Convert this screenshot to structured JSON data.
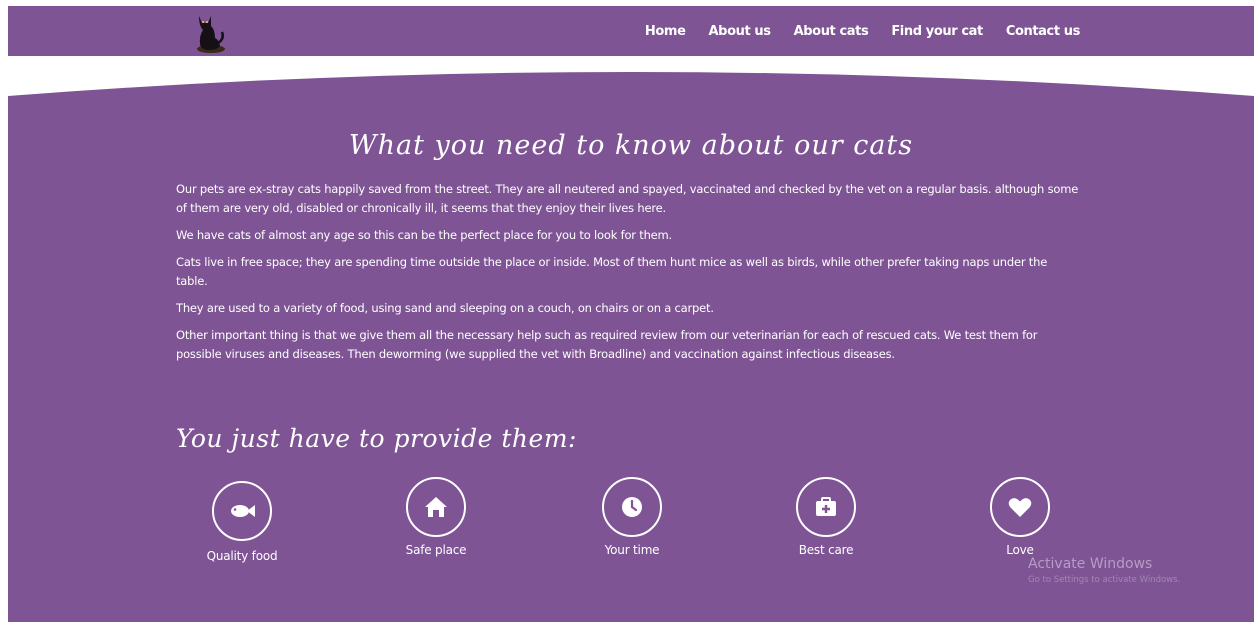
{
  "nav": {
    "links": [
      "Home",
      "About us",
      "About cats",
      "Find your cat",
      "Contact us"
    ]
  },
  "main": {
    "title": "What you need to know about our cats",
    "paragraphs": [
      "Our pets are ex-stray cats happily saved from the street. They are all neutered and spayed, vaccinated and checked by the vet on a regular basis. although some of them are very old, disabled or chronically ill, it seems that they enjoy their lives here.",
      "We have cats of almost any age so this can be the perfect place for you to look for them.",
      "Cats live in free space; they are spending time outside the place or inside. Most of them hunt mice as well as birds, while other prefer taking naps under the table.",
      "They are used to a variety of food, using sand and sleeping on a couch, on chairs or on a carpet.",
      "Other important thing is that we give them all the necessary help such as required review from our veterinarian for each of rescued cats. We test them for possible viruses and diseases. Then deworming (we supplied the vet with Broadline) and vaccination against infectious diseases."
    ],
    "provide_title": "You just have to provide them:",
    "features": [
      {
        "label": "Quality food",
        "icon": "fish-icon"
      },
      {
        "label": "Safe place",
        "icon": "home-icon"
      },
      {
        "label": "Your time",
        "icon": "clock-icon"
      },
      {
        "label": "Best care",
        "icon": "medkit-icon"
      },
      {
        "label": "Love",
        "icon": "heart-icon"
      }
    ]
  },
  "watermark": {
    "title": "Activate Windows",
    "subtitle": "Go to Settings to activate Windows."
  },
  "colors": {
    "brand_purple": "#7e5494",
    "text": "#ffffff"
  }
}
